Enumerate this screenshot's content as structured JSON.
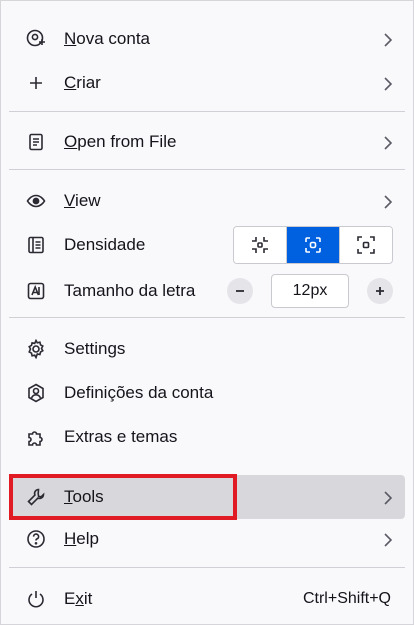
{
  "menu": {
    "new_account": {
      "prefix": "",
      "accel": "N",
      "rest": "ova conta"
    },
    "create": {
      "prefix": "",
      "accel": "C",
      "rest": "riar"
    },
    "open_file": {
      "prefix": "",
      "accel": "O",
      "rest": "pen from File"
    },
    "view": {
      "prefix": "",
      "accel": "V",
      "rest": "iew"
    },
    "density": {
      "label": "Densidade",
      "options": [
        "compact",
        "normal",
        "touch"
      ],
      "selected": "normal"
    },
    "font_size": {
      "label": "Tamanho da letra",
      "value": "12px"
    },
    "settings": {
      "label": "Settings"
    },
    "account_settings": {
      "label": "Definições da conta"
    },
    "addons": {
      "label": "Extras e temas"
    },
    "tools": {
      "prefix": "",
      "accel": "T",
      "rest": "ools"
    },
    "help": {
      "prefix": "",
      "accel": "H",
      "rest": "elp"
    },
    "exit": {
      "prefix": "E",
      "accel": "x",
      "rest": "it",
      "shortcut": "Ctrl+Shift+Q"
    }
  },
  "colors": {
    "accent": "#0061e0",
    "highlight": "#e01b24",
    "hover": "#d8d8dc"
  }
}
